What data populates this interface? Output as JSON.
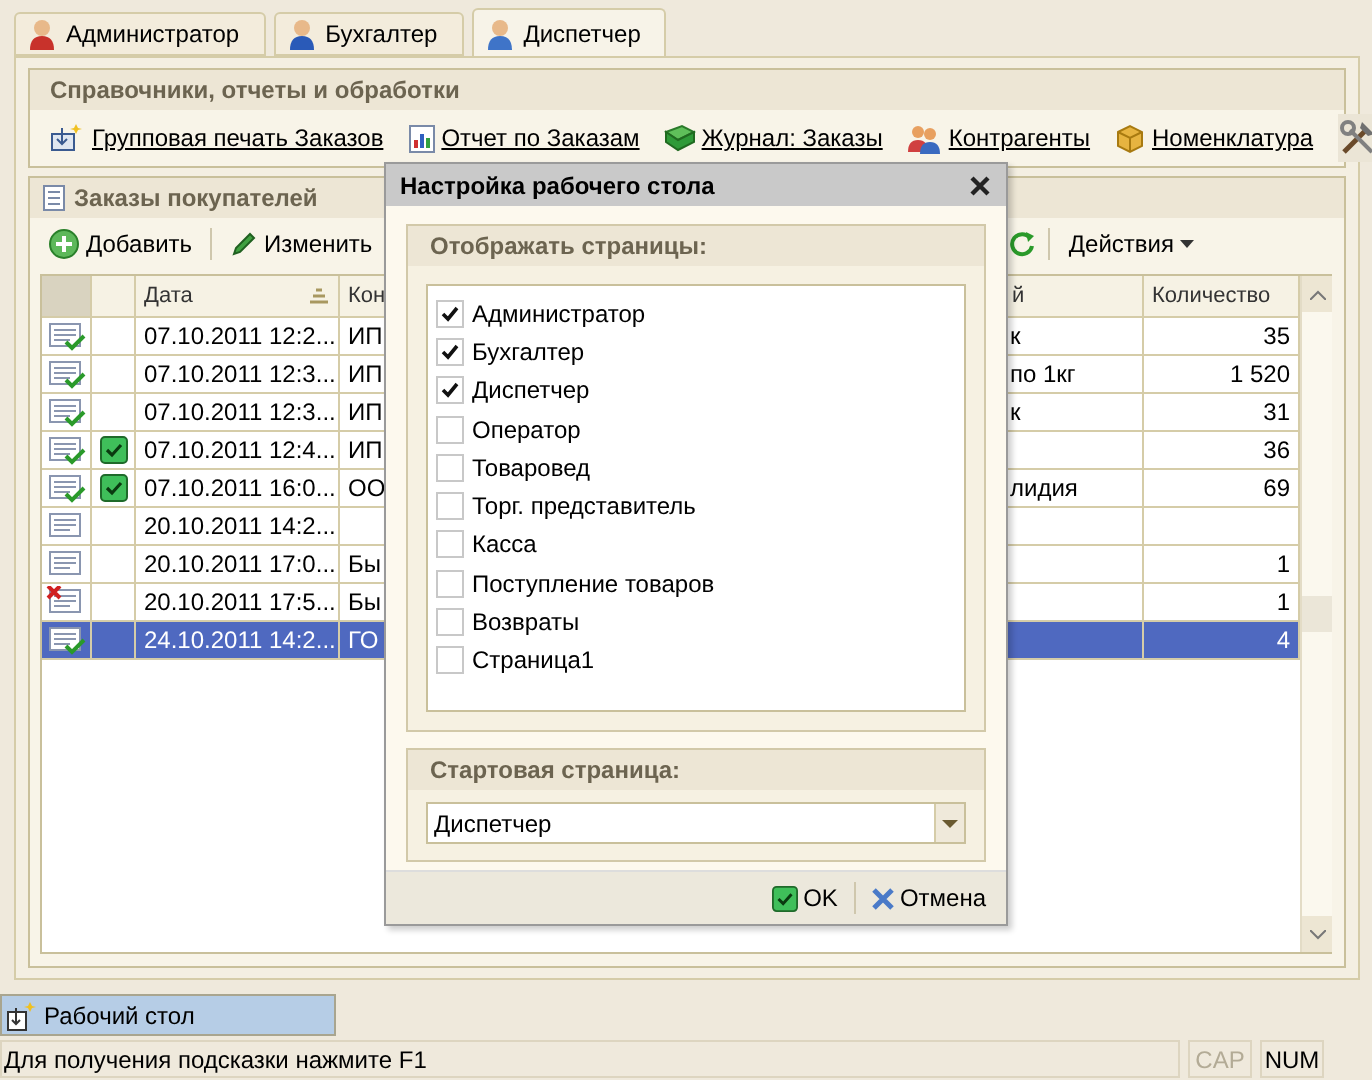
{
  "tabs": [
    {
      "label": "Администратор",
      "selected": false
    },
    {
      "label": "Бухгалтер",
      "selected": false
    },
    {
      "label": "Диспетчер",
      "selected": true
    }
  ],
  "quick_links": {
    "title": "Справочники, отчеты и обработки",
    "links": [
      {
        "kind": "print",
        "label": "Групповая печать Заказов"
      },
      {
        "kind": "report",
        "label": "Отчет по Заказам"
      },
      {
        "kind": "journal",
        "label": "Журнал: Заказы"
      },
      {
        "kind": "people",
        "label": "Контрагенты"
      },
      {
        "kind": "box",
        "label": "Номенклатура"
      }
    ]
  },
  "orders": {
    "title": "Заказы покупателей",
    "toolbar": {
      "add": "Добавить",
      "edit": "Изменить",
      "actions": "Действия"
    },
    "table": {
      "columns": [
        "Дата",
        "Кон",
        "й",
        "Количество"
      ],
      "rows": [
        {
          "kind": "posted",
          "flag": false,
          "date": "07.10.2011 12:2...",
          "column_2": "ИП",
          "column_3": "к",
          "quantity": "35",
          "selected": false
        },
        {
          "kind": "posted",
          "flag": false,
          "date": "07.10.2011 12:3...",
          "column_2": "ИП",
          "column_3": "по 1кг",
          "quantity": "1 520",
          "selected": false
        },
        {
          "kind": "posted",
          "flag": false,
          "date": "07.10.2011 12:3...",
          "column_2": "ИП",
          "column_3": "к",
          "quantity": "31",
          "selected": false
        },
        {
          "kind": "posted",
          "flag": true,
          "date": "07.10.2011 12:4...",
          "column_2": "ИП",
          "quantity": "36",
          "selected": false
        },
        {
          "kind": "posted",
          "flag": true,
          "date": "07.10.2011 16:0...",
          "column_2": "ОО",
          "column_3": "лидия",
          "quantity": "69",
          "selected": false
        },
        {
          "kind": "draft",
          "flag": false,
          "date": "20.10.2011 14:2...",
          "selected": false
        },
        {
          "kind": "draft",
          "flag": false,
          "date": "20.10.2011 17:0...",
          "column_2": "Бы",
          "quantity": "1",
          "selected": false
        },
        {
          "kind": "deleted",
          "flag": false,
          "date": "20.10.2011 17:5...",
          "column_2": "Бы",
          "quantity": "1",
          "selected": false
        },
        {
          "kind": "posted",
          "flag": false,
          "date": "24.10.2011 14:2...",
          "column_2": "ГО",
          "quantity": "4",
          "selected": true
        }
      ]
    }
  },
  "dialog": {
    "title": "Настройка рабочего стола",
    "pages_group": "Отображать страницы:",
    "pages": [
      {
        "label": "Администратор",
        "checked": true
      },
      {
        "label": "Бухгалтер",
        "checked": true
      },
      {
        "label": "Диспетчер",
        "checked": true
      },
      {
        "label": "Оператор",
        "checked": false
      },
      {
        "label": "Товаровед",
        "checked": false
      },
      {
        "label": "Торг. представитель",
        "checked": false
      },
      {
        "label": "Касса",
        "checked": false
      },
      {
        "label": "Поступление товаров",
        "checked": false
      },
      {
        "label": "Возвраты",
        "checked": false
      },
      {
        "label": "Страница1",
        "checked": false
      }
    ],
    "start_group": "Стартовая страница:",
    "start_page": "Диспетчер",
    "ok": "OK",
    "cancel": "Отмена"
  },
  "taskbar": {
    "items": [
      {
        "label": "Рабочий стол",
        "selected": true
      }
    ]
  },
  "status_bar": {
    "hint": "Для получения подсказки нажмите F1",
    "indicators": [
      {
        "label": "CAP",
        "on": false
      },
      {
        "label": "NUM",
        "on": true
      }
    ]
  }
}
